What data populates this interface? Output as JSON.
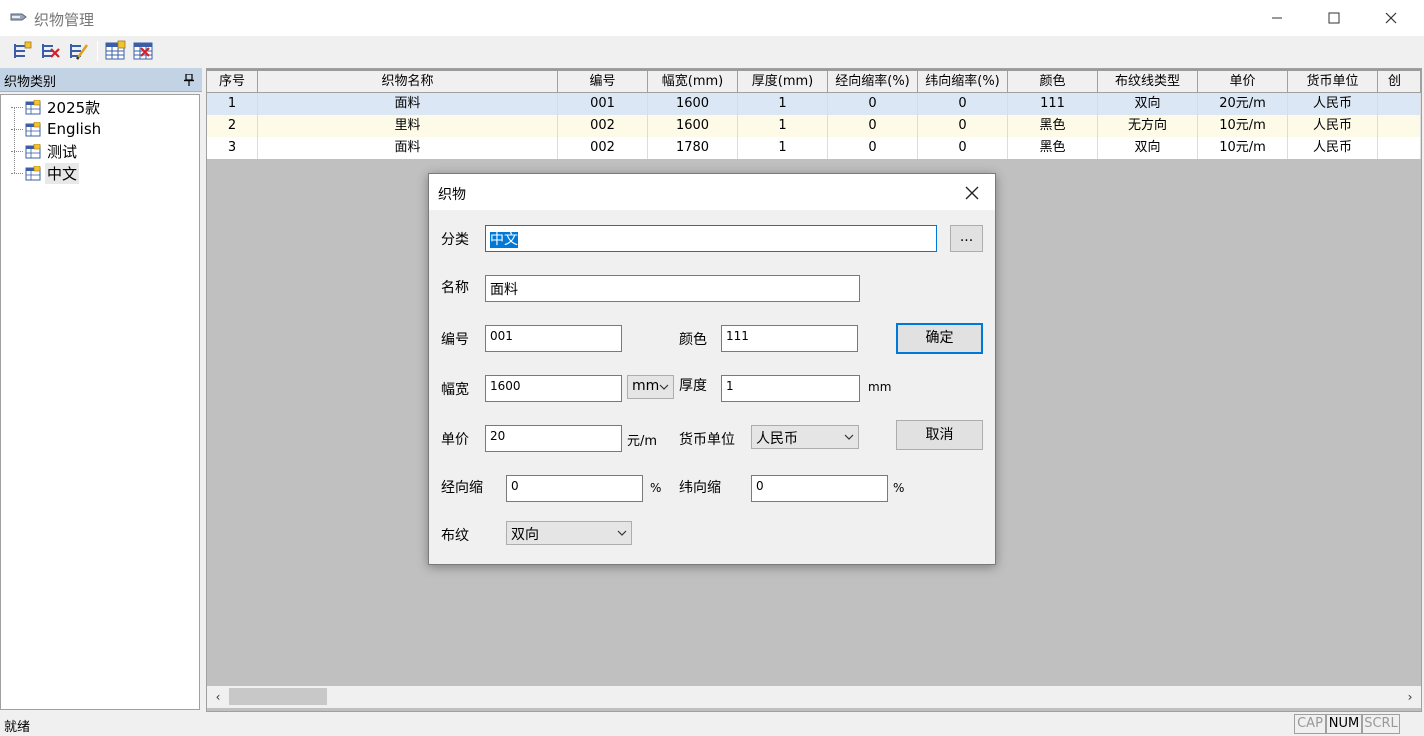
{
  "window": {
    "title": "织物管理"
  },
  "toolbar": {
    "buttons": [
      "add-item",
      "delete-item",
      "edit-item",
      "table-add",
      "table-delete"
    ]
  },
  "left_pane": {
    "title": "织物类别",
    "items": [
      {
        "label": "2025款"
      },
      {
        "label": "English"
      },
      {
        "label": "测试"
      },
      {
        "label": "中文"
      }
    ]
  },
  "grid": {
    "columns": [
      "序号",
      "织物名称",
      "编号",
      "幅宽(mm)",
      "厚度(mm)",
      "经向缩率(%)",
      "纬向缩率(%)",
      "颜色",
      "布纹线类型",
      "单价",
      "货币单位",
      "创"
    ],
    "rows": [
      [
        "1",
        "面料",
        "001",
        "1600",
        "1",
        "0",
        "0",
        "111",
        "双向",
        "20元/m",
        "人民币",
        ""
      ],
      [
        "2",
        "里料",
        "002",
        "1600",
        "1",
        "0",
        "0",
        "黑色",
        "无方向",
        "10元/m",
        "人民币",
        ""
      ],
      [
        "3",
        "面料",
        "002",
        "1780",
        "1",
        "0",
        "0",
        "黑色",
        "双向",
        "10元/m",
        "人民币",
        ""
      ]
    ]
  },
  "status": {
    "ready": "就绪",
    "indicators": [
      {
        "label": "CAP",
        "active": false
      },
      {
        "label": "NUM",
        "active": true
      },
      {
        "label": "SCRL",
        "active": false
      }
    ]
  },
  "dialog": {
    "title": "织物",
    "category_label": "分类",
    "category_value": "中文",
    "browse_label": "...",
    "name_label": "名称",
    "name_value": "面料",
    "code_label": "编号",
    "code_value": "001",
    "color_label": "颜色",
    "color_value": "111",
    "ok_label": "确定",
    "width_label": "幅宽",
    "width_value": "1600",
    "width_unit": "mm",
    "thickness_label": "厚度",
    "thickness_value": "1",
    "thickness_unit": "mm",
    "price_label": "单价",
    "price_value": "20",
    "price_unit": "元/m",
    "currency_label": "货币单位",
    "currency_value": "人民币",
    "cancel_label": "取消",
    "warp_label": "经向缩",
    "warp_value": "0",
    "warp_unit": "%",
    "weft_label": "纬向缩",
    "weft_value": "0",
    "weft_unit": "%",
    "grain_label": "布纹",
    "grain_value": "双向"
  }
}
